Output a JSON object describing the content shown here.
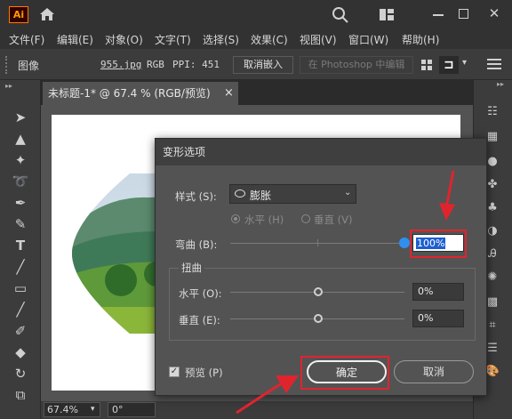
{
  "app": {
    "logo": "Ai"
  },
  "menu": [
    "文件(F)",
    "编辑(E)",
    "对象(O)",
    "文字(T)",
    "选择(S)",
    "效果(C)",
    "视图(V)",
    "窗口(W)",
    "帮助(H)"
  ],
  "control_bar": {
    "panel_label": "图像",
    "filename": "955.jpg",
    "color_mode": "RGB",
    "ppi": "PPI: 451",
    "unembed_button": "取消嵌入",
    "photoshop_button": "在 Photoshop 中编辑"
  },
  "document_tab": {
    "title": "未标题-1* @ 67.4 % (RGB/预览)",
    "close": "×"
  },
  "status_bar": {
    "zoom": "67.4%",
    "angle": "0°"
  },
  "dialog": {
    "title": "变形选项",
    "style_label": "样式 (S):",
    "style_value": "膨胀",
    "horizontal_radio": "水平 (H)",
    "vertical_radio": "垂直 (V)",
    "bend_label": "弯曲 (B):",
    "bend_value": "100%",
    "bend_level": 1.0,
    "distort_group": "扭曲",
    "dist_h_label": "水平 (O):",
    "dist_h_value": "0%",
    "dist_v_label": "垂直 (E):",
    "dist_v_value": "0%",
    "preview_label": "预览 (P)",
    "ok_button": "确定",
    "cancel_button": "取消"
  },
  "colors": {
    "highlight": "#e0242e",
    "accent": "#2f8ff0",
    "selection": "#1e5fd0"
  }
}
